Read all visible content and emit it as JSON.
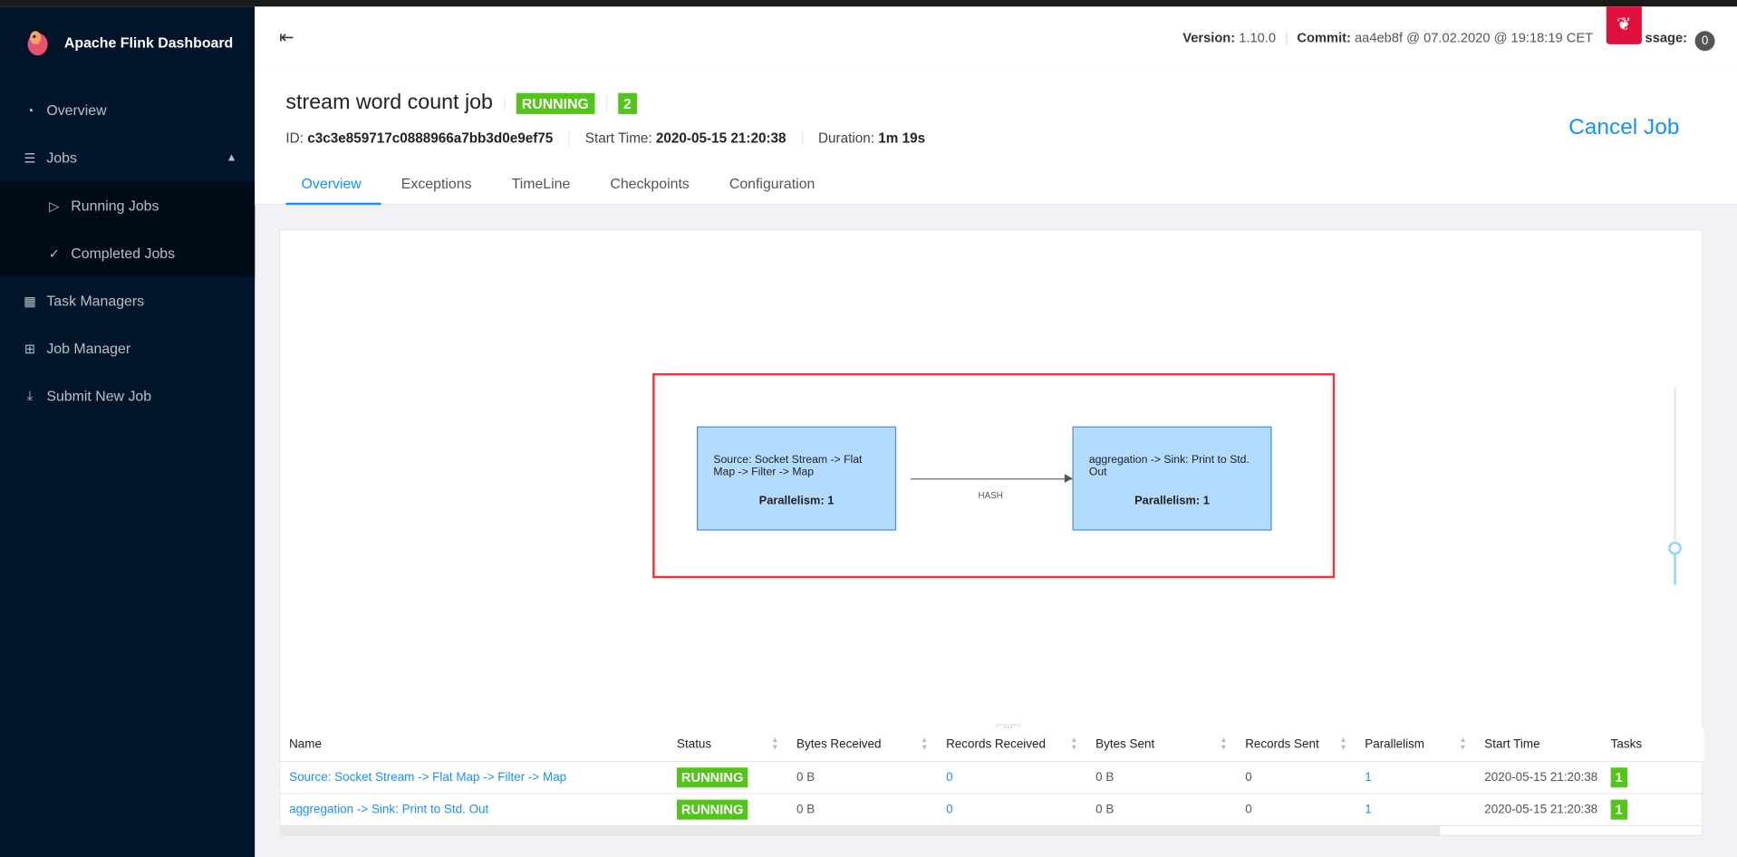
{
  "app": {
    "title": "Apache Flink Dashboard"
  },
  "sidebar": {
    "items": [
      {
        "label": "Overview",
        "icon": "dashboard-icon"
      },
      {
        "label": "Jobs",
        "icon": "list-icon",
        "expanded": true
      },
      {
        "label": "Running Jobs",
        "icon": "play-circle-icon"
      },
      {
        "label": "Completed Jobs",
        "icon": "check-circle-icon"
      },
      {
        "label": "Task Managers",
        "icon": "calendar-icon"
      },
      {
        "label": "Job Manager",
        "icon": "cluster-icon"
      },
      {
        "label": "Submit New Job",
        "icon": "upload-icon"
      }
    ]
  },
  "header": {
    "version_label": "Version:",
    "version": "1.10.0",
    "commit_label": "Commit:",
    "commit": "aa4eb8f @ 07.02.2020 @ 19:18:19 CET",
    "message_label": "ssage:",
    "message_count": "0"
  },
  "job": {
    "name": "stream word count job",
    "status": "RUNNING",
    "count": "2",
    "id_label": "ID:",
    "id": "c3c3e859717c0888966a7bb3d0e9ef75",
    "start_label": "Start Time:",
    "start": "2020-05-15 21:20:38",
    "duration_label": "Duration:",
    "duration": "1m 19s",
    "cancel": "Cancel Job"
  },
  "tabs": [
    "Overview",
    "Exceptions",
    "TimeLine",
    "Checkpoints",
    "Configuration"
  ],
  "graph": {
    "nodes": [
      {
        "label": "Source: Socket Stream -> Flat Map -> Filter -> Map",
        "parallelism": "Parallelism: 1"
      },
      {
        "label": "aggregation -> Sink: Print to Std. Out",
        "parallelism": "Parallelism: 1"
      }
    ],
    "edge_label": "HASH",
    "zoom_level": 0.2,
    "highlight_color": "#e53935"
  },
  "table": {
    "columns": [
      "Name",
      "Status",
      "Bytes Received",
      "Records Received",
      "Bytes Sent",
      "Records Sent",
      "Parallelism",
      "Start Time",
      "Tasks"
    ],
    "rows": [
      [
        "Source: Socket Stream -> Flat Map -> Filter -> Map",
        "RUNNING",
        "0 B",
        "0",
        "0 B",
        "0",
        "1",
        "2020-05-15 21:20:38",
        "1"
      ],
      [
        "aggregation -> Sink: Print to Std. Out",
        "RUNNING",
        "0 B",
        "0",
        "0 B",
        "0",
        "1",
        "2020-05-15 21:20:38",
        "1"
      ]
    ]
  },
  "colors": {
    "accent": "#1890ff",
    "running": "#52c41a",
    "sidebar": "#001529"
  }
}
